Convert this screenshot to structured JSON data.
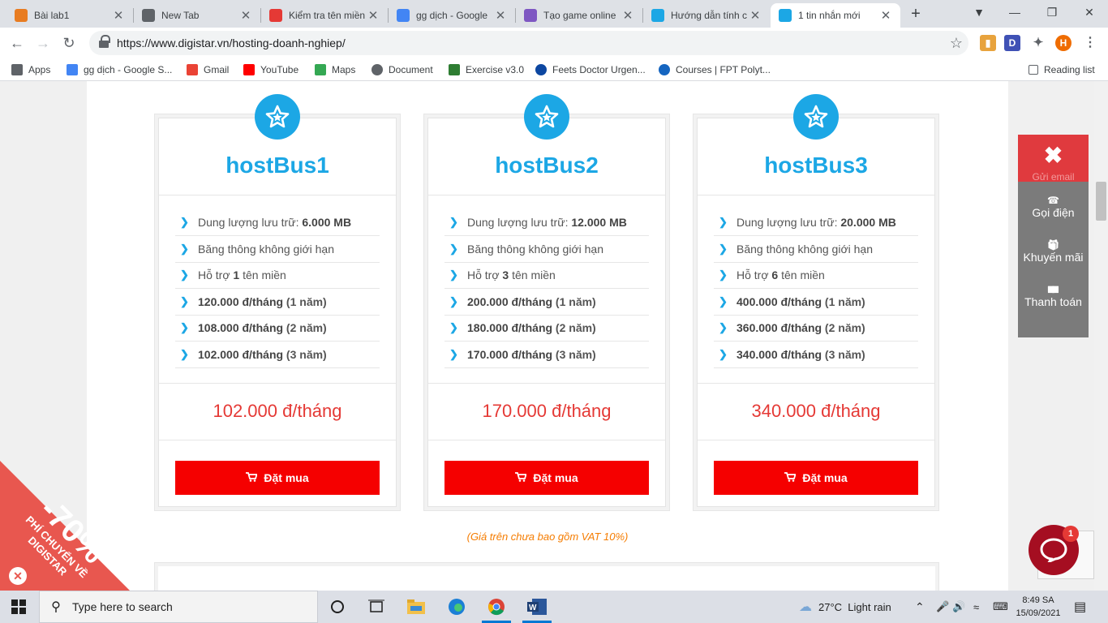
{
  "browser": {
    "tabs": [
      {
        "title": "Bài lab1",
        "icon": "orange-doc-icon",
        "color": "#e87c21"
      },
      {
        "title": "New Tab",
        "icon": "chrome-icon",
        "color": "#5f6368"
      },
      {
        "title": "Kiểm tra tên miền",
        "icon": "opera-icon",
        "color": "#e53935"
      },
      {
        "title": "gg dịch - Google",
        "icon": "google-icon",
        "color": "#4285f4"
      },
      {
        "title": "Tạo game online",
        "icon": "purple-h-icon",
        "color": "#7e57c2"
      },
      {
        "title": "Hướng dẫn tính c",
        "icon": "digistar-icon",
        "color": "#1ca7e5"
      },
      {
        "title": "1 tin nhắn mới",
        "icon": "digistar-icon",
        "color": "#1ca7e5"
      }
    ],
    "active_tab": 6,
    "url": "https://www.digistar.vn/hosting-doanh-nghiep/",
    "profile_initial": "H",
    "extension_initial": "D",
    "bookmarks": [
      {
        "label": "Apps",
        "icon": "apps-grid-icon",
        "color": "#5f6368"
      },
      {
        "label": "gg dịch - Google S...",
        "icon": "google-icon",
        "color": "#4285f4"
      },
      {
        "label": "Gmail",
        "icon": "gmail-icon",
        "color": "#ea4335"
      },
      {
        "label": "YouTube",
        "icon": "youtube-icon",
        "color": "#ff0000"
      },
      {
        "label": "Maps",
        "icon": "maps-pin-icon",
        "color": "#34a853"
      },
      {
        "label": "Document",
        "icon": "globe-icon",
        "color": "#5f6368"
      },
      {
        "label": "Exercise v3.0",
        "icon": "w3-icon",
        "color": "#2e7d32"
      },
      {
        "label": "Feets Doctor Urgen...",
        "icon": "feets-icon",
        "color": "#0d47a1"
      },
      {
        "label": "Courses | FPT Polyt...",
        "icon": "courses-icon",
        "color": "#1565c0"
      }
    ],
    "reading_list": "Reading list"
  },
  "plans": [
    {
      "name": "hostBus1",
      "features": [
        {
          "pre": "Dung lượng lưu trữ: ",
          "bold": "6.000 MB",
          "post": ""
        },
        {
          "pre": "Băng thông không giới hạn",
          "bold": "",
          "post": ""
        },
        {
          "pre": "Hỗ trợ ",
          "bold": "1",
          "post": " tên miền"
        },
        {
          "pre": "",
          "bold": "120.000 đ/tháng",
          "post": " (1 năm)"
        },
        {
          "pre": "",
          "bold": "108.000 đ/tháng",
          "post": " (2 năm)"
        },
        {
          "pre": "",
          "bold": "102.000 đ/tháng",
          "post": " (3 năm)"
        }
      ],
      "price": "102.000 đ/tháng",
      "button": "Đặt mua"
    },
    {
      "name": "hostBus2",
      "features": [
        {
          "pre": "Dung lượng lưu trữ: ",
          "bold": "12.000 MB",
          "post": ""
        },
        {
          "pre": "Băng thông không giới hạn",
          "bold": "",
          "post": ""
        },
        {
          "pre": "Hỗ trợ ",
          "bold": "3",
          "post": " tên miền"
        },
        {
          "pre": "",
          "bold": "200.000 đ/tháng",
          "post": " (1 năm)"
        },
        {
          "pre": "",
          "bold": "180.000 đ/tháng",
          "post": " (2 năm)"
        },
        {
          "pre": "",
          "bold": "170.000 đ/tháng",
          "post": " (3 năm)"
        }
      ],
      "price": "170.000 đ/tháng",
      "button": "Đặt mua"
    },
    {
      "name": "hostBus3",
      "features": [
        {
          "pre": "Dung lượng lưu trữ: ",
          "bold": "20.000 MB",
          "post": ""
        },
        {
          "pre": "Băng thông không giới hạn",
          "bold": "",
          "post": ""
        },
        {
          "pre": "Hỗ trợ ",
          "bold": "6",
          "post": " tên miền"
        },
        {
          "pre": "",
          "bold": "400.000 đ/tháng",
          "post": " (1 năm)"
        },
        {
          "pre": "",
          "bold": "360.000 đ/tháng",
          "post": " (2 năm)"
        },
        {
          "pre": "",
          "bold": "340.000 đ/tháng",
          "post": " (3 năm)"
        }
      ],
      "price": "340.000 đ/tháng",
      "button": "Đặt mua"
    }
  ],
  "vat_note": "(Giá trên chưa bao gồm VAT 10%)",
  "contact_widget": {
    "close_label": "Gửi email",
    "items": [
      {
        "label": "Gọi điện",
        "icon": "phone-icon"
      },
      {
        "label": "Khuyến mãi",
        "icon": "gift-icon"
      },
      {
        "label": "Thanh toán",
        "icon": "money-icon"
      }
    ]
  },
  "promo": {
    "discount": "-70%",
    "line1": "PHÍ CHUYỂN VỀ",
    "line2": "DIGISTAR"
  },
  "chat": {
    "badge": "1"
  },
  "taskbar": {
    "search_placeholder": "Type here to search",
    "weather": "27°C  Light rain",
    "time": "8:49 SA",
    "date": "15/09/2021"
  },
  "colors": {
    "accent_blue": "#1ca7e5",
    "price_red": "#e53935",
    "button_red": "#f50000",
    "vat_orange": "#f57c00",
    "widget_red": "#e03a3e",
    "widget_gray": "#7b7b7b"
  }
}
